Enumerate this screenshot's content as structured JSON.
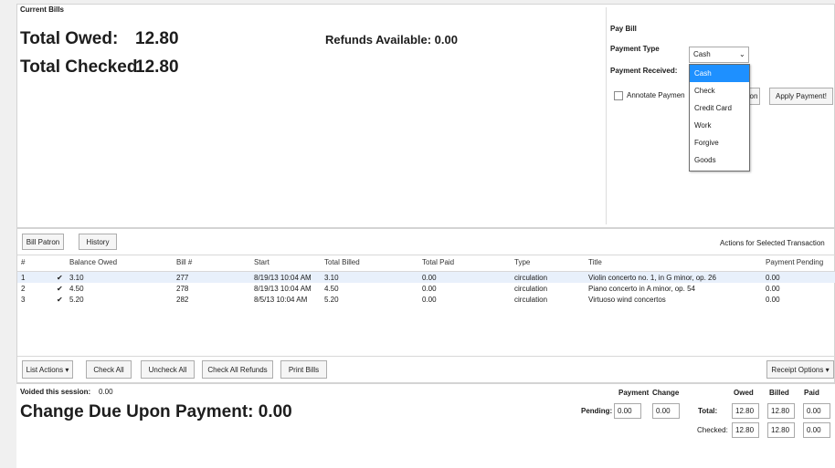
{
  "current_bills": {
    "group_label": "Current Bills",
    "total_owed_label": "Total Owed:",
    "total_owed_value": "12.80",
    "total_checked_label": "Total Checked:",
    "total_checked_value": "12.80",
    "refunds_label": "Refunds Available: 0.00"
  },
  "pay_bill": {
    "group_label": "Pay Bill",
    "payment_type_label": "Payment Type",
    "payment_type_value": "Cash",
    "payment_received_label": "Payment Received:",
    "annotate_label": "Annotate Paymen",
    "annotate_suffix": "on",
    "apply_button": "Apply Payment!",
    "dropdown_options": [
      "Cash",
      "Check",
      "Credit Card",
      "Work",
      "Forgive",
      "Goods"
    ]
  },
  "toolbar": {
    "bill_patron": "Bill Patron",
    "history": "History",
    "actions_selected": "Actions for Selected Transaction"
  },
  "grid": {
    "columns": [
      "#",
      "Balance Owed",
      "Bill #",
      "Start",
      "Total Billed",
      "Total Paid",
      "Type",
      "Title",
      "Payment Pending"
    ],
    "rows": [
      {
        "num": "1",
        "check": "✔",
        "balance": "3.10",
        "bill": "277",
        "start": "8/19/13 10:04 AM",
        "billed": "3.10",
        "paid": "0.00",
        "type": "circulation",
        "title": "Violin concerto no. 1, in G minor, op. 26",
        "pending": "0.00"
      },
      {
        "num": "2",
        "check": "✔",
        "balance": "4.50",
        "bill": "278",
        "start": "8/19/13 10:04 AM",
        "billed": "4.50",
        "paid": "0.00",
        "type": "circulation",
        "title": "Piano concerto in A minor, op. 54",
        "pending": "0.00"
      },
      {
        "num": "3",
        "check": "✔",
        "balance": "5.20",
        "bill": "282",
        "start": "8/5/13 10:04 AM",
        "billed": "5.20",
        "paid": "0.00",
        "type": "circulation",
        "title": "Virtuoso wind concertos",
        "pending": "0.00"
      }
    ]
  },
  "bottom_toolbar": {
    "list_actions": "List Actions ▾",
    "check_all": "Check All",
    "uncheck_all": "Uncheck All",
    "check_all_refunds": "Check All Refunds",
    "print_bills": "Print Bills",
    "receipt_options": "Receipt Options ▾"
  },
  "footer": {
    "voided_label": "Voided this session:",
    "voided_value": "0.00",
    "change_due": "Change Due Upon Payment: 0.00",
    "payment_header": "Payment",
    "change_header": "Change",
    "owed_header": "Owed",
    "billed_header": "Billed",
    "paid_header": "Paid",
    "pending_label": "Pending:",
    "pending_payment": "0.00",
    "pending_change": "0.00",
    "total_label": "Total:",
    "checked_label": "Checked:",
    "total_owed": "12.80",
    "total_billed": "12.80",
    "total_paid": "0.00",
    "checked_owed": "12.80",
    "checked_billed": "12.80",
    "checked_paid": "0.00"
  }
}
